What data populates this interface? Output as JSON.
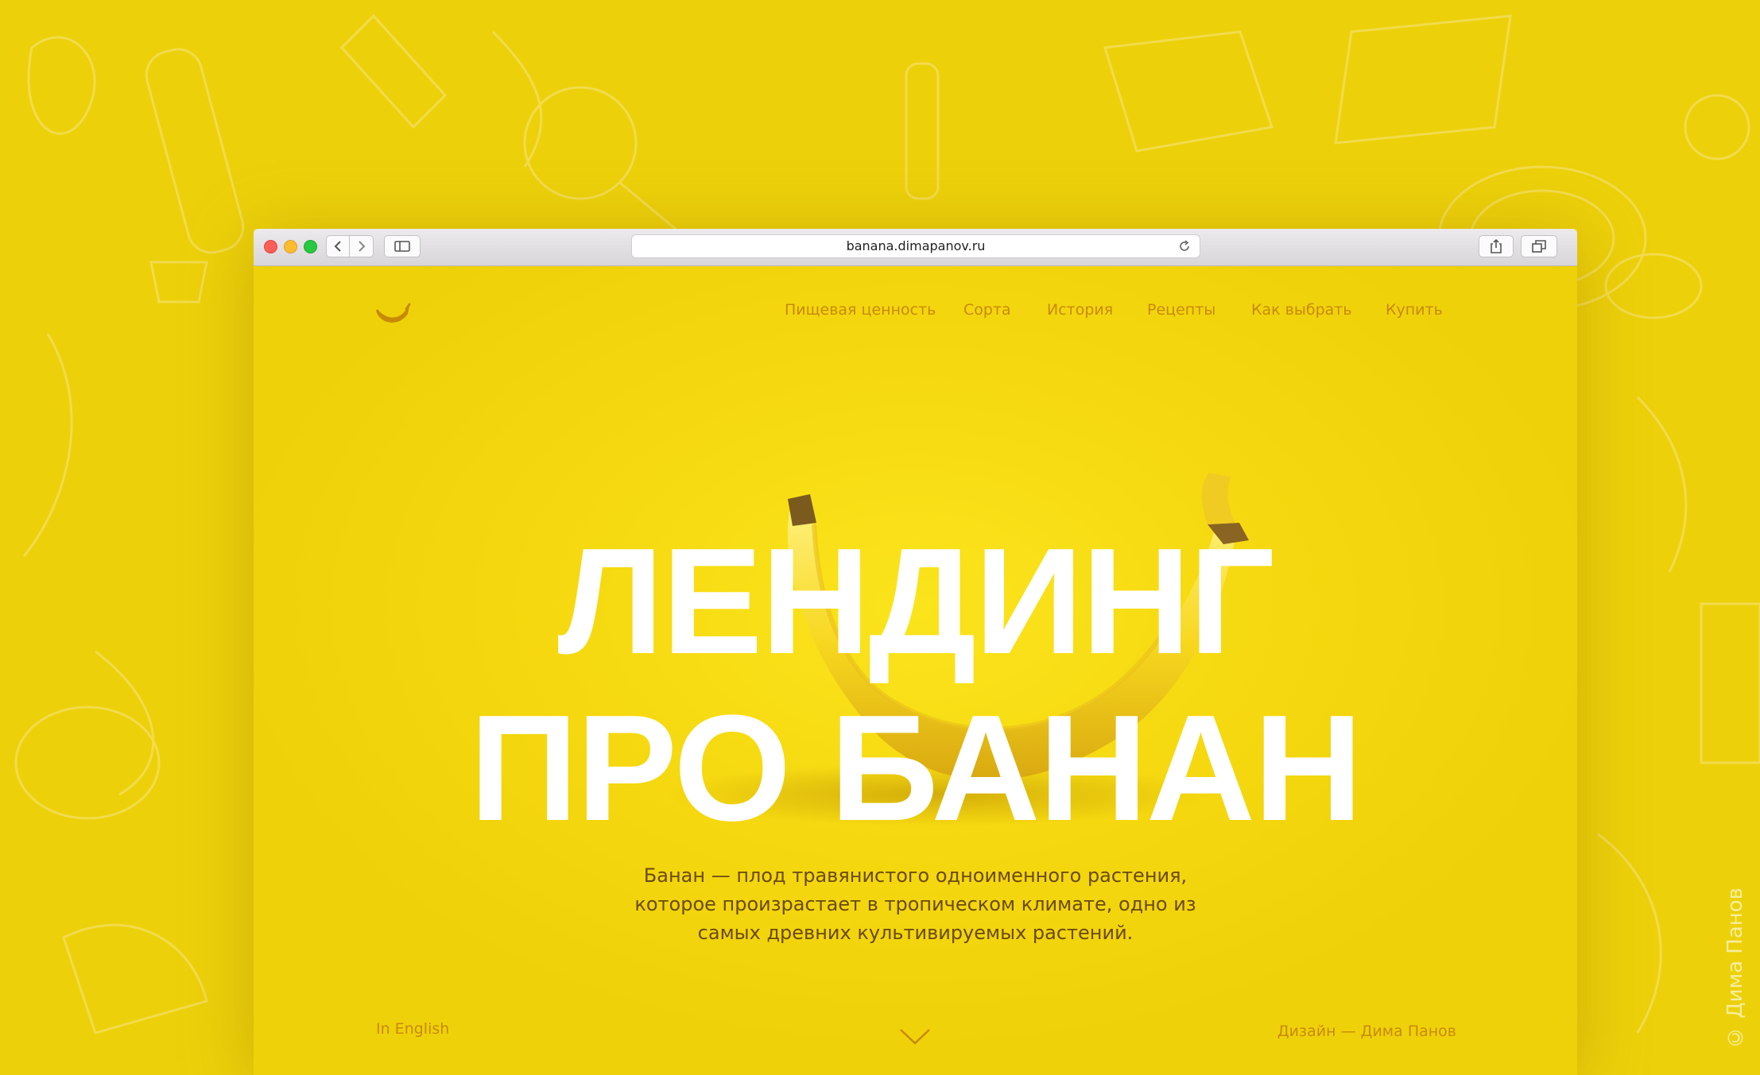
{
  "watermark": "© Дима Панов",
  "browser": {
    "url": "banana.dimapanov.ru"
  },
  "nav": {
    "items": [
      {
        "label": "Пищевая ценность"
      },
      {
        "label": "Сорта"
      },
      {
        "label": "История"
      },
      {
        "label": "Рецепты"
      },
      {
        "label": "Как выбрать"
      },
      {
        "label": "Купить"
      }
    ]
  },
  "hero": {
    "line1": "ЛЕНДИНГ",
    "line2": "ПРО БАНАН"
  },
  "description": {
    "line1": "Банан — плод травянистого одноименного растения,",
    "line2": "которое произрастает в тропическом климате, одно из",
    "line3": "самых древних культивируемых растений."
  },
  "footer": {
    "language_link": "In English",
    "credit": "Дизайн — Дима Панов"
  },
  "icons": {
    "logo": "banana-logo-icon",
    "scroll": "chevron-down-icon",
    "reload": "reload-icon",
    "share": "share-icon",
    "tabs": "tabs-icon",
    "sidebar": "sidebar-icon"
  },
  "colors": {
    "background": "#ecd10a",
    "page": "#f2d50d",
    "accent": "#c88a06",
    "text": "#6b4a0c",
    "hero_text": "#ffffff"
  }
}
